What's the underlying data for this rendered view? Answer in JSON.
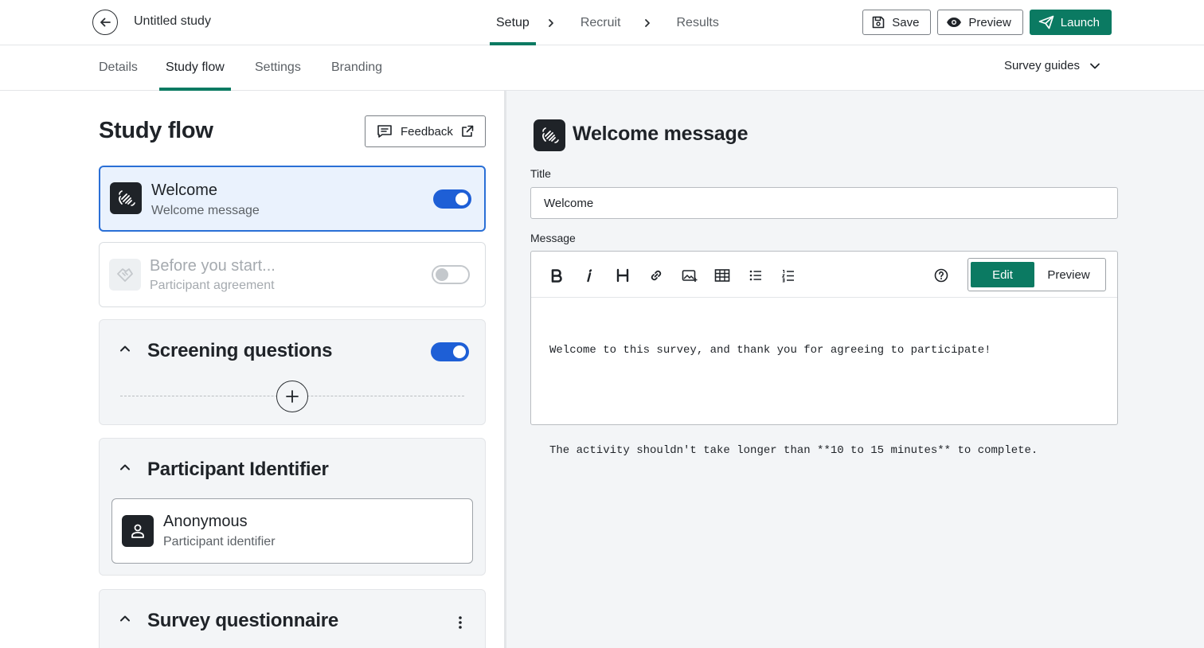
{
  "header": {
    "study_title": "Untitled study",
    "steps": [
      {
        "label": "Setup",
        "active": true
      },
      {
        "label": "Recruit",
        "active": false
      },
      {
        "label": "Results",
        "active": false
      }
    ],
    "actions": {
      "save": "Save",
      "preview": "Preview",
      "launch": "Launch"
    }
  },
  "subtabs": {
    "items": [
      {
        "label": "Details",
        "active": false
      },
      {
        "label": "Study flow",
        "active": true
      },
      {
        "label": "Settings",
        "active": false
      },
      {
        "label": "Branding",
        "active": false
      }
    ],
    "guides_label": "Survey guides"
  },
  "left": {
    "title": "Study flow",
    "feedback_label": "Feedback",
    "cards": [
      {
        "title": "Welcome",
        "subtitle": "Welcome message",
        "enabled": true,
        "selected": true,
        "icon": "hand-wave-icon"
      },
      {
        "title": "Before you start...",
        "subtitle": "Participant agreement",
        "enabled": false,
        "selected": false,
        "icon": "handshake-icon"
      }
    ],
    "screening": {
      "title": "Screening questions",
      "enabled": true
    },
    "identifier": {
      "title": "Participant Identifier",
      "item_title": "Anonymous",
      "item_subtitle": "Participant identifier",
      "icon": "person-icon"
    },
    "questionnaire": {
      "title": "Survey questionnaire"
    }
  },
  "right": {
    "title": "Welcome message",
    "title_label": "Title",
    "title_value": "Welcome",
    "message_label": "Message",
    "mode_edit": "Edit",
    "mode_preview": "Preview",
    "message_lines": [
      "Welcome to this survey, and thank you for agreeing to participate!",
      "",
      "The activity shouldn't take longer than **10 to 15 minutes** to complete."
    ]
  },
  "colors": {
    "accent": "#0b7a62",
    "toggle_on": "#1e5fd6",
    "selected_border": "#2a6fd6"
  }
}
